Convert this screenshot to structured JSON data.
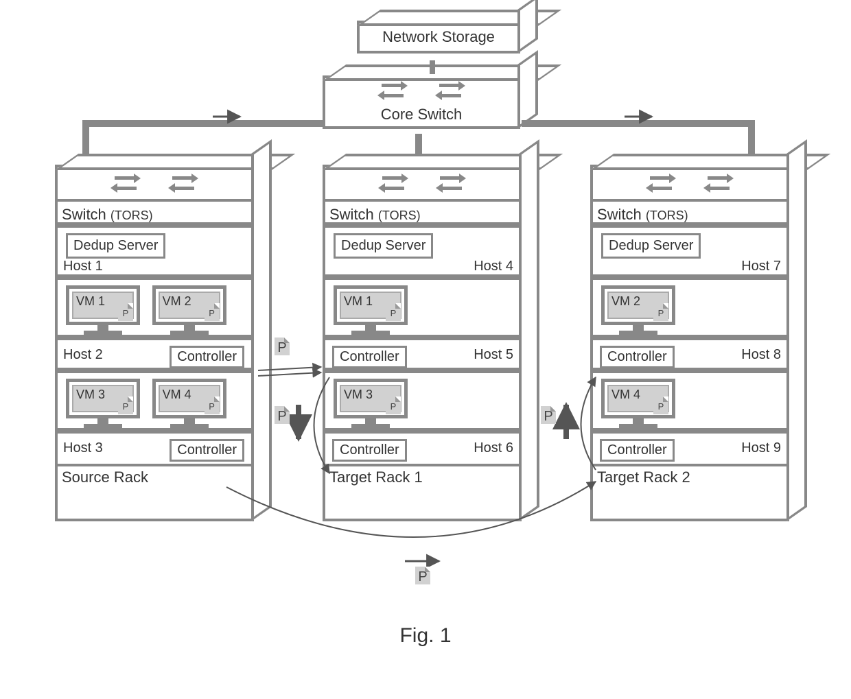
{
  "figure_caption": "Fig. 1",
  "storage_label": "Network Storage",
  "core_switch_label": "Core Switch",
  "switch_label": "Switch",
  "tors_label": "(TORS)",
  "dedup_label": "Dedup Server",
  "controller_label": "Controller",
  "p_label": "P",
  "racks": {
    "source": {
      "name": "Source Rack",
      "host1": "Host 1",
      "host2": "Host 2",
      "host3": "Host 3",
      "vm1": "VM 1",
      "vm2": "VM 2",
      "vm3": "VM 3",
      "vm4": "VM 4"
    },
    "target1": {
      "name": "Target Rack 1",
      "host1": "Host 4",
      "host2": "Host 5",
      "host3": "Host 6",
      "vm1": "VM 1",
      "vm3": "VM 3"
    },
    "target2": {
      "name": "Target Rack 2",
      "host1": "Host 7",
      "host2": "Host 8",
      "host3": "Host 9",
      "vm2": "VM 2",
      "vm4": "VM 4"
    }
  },
  "chart_data": {
    "type": "network-diagram",
    "nodes": [
      {
        "id": "net_storage",
        "label": "Network Storage"
      },
      {
        "id": "core_switch",
        "label": "Core Switch"
      },
      {
        "id": "rack_src",
        "label": "Source Rack",
        "contains": [
          "Switch (TORS)",
          "Host 1 (Dedup Server)",
          "Host 2 (VM 1, VM 2, Controller)",
          "Host 3 (VM 3, VM 4, Controller)"
        ]
      },
      {
        "id": "rack_t1",
        "label": "Target Rack 1",
        "contains": [
          "Switch (TORS)",
          "Host 4 (Dedup Server)",
          "Host 5 (VM 1, Controller)",
          "Host 6 (VM 3, Controller)"
        ]
      },
      {
        "id": "rack_t2",
        "label": "Target Rack 2",
        "contains": [
          "Switch (TORS)",
          "Host 7 (Dedup Server)",
          "Host 8 (VM 2, Controller)",
          "Host 9 (VM 4, Controller)"
        ]
      }
    ],
    "edges": [
      {
        "from": "net_storage",
        "to": "core_switch"
      },
      {
        "from": "core_switch",
        "to": "rack_src"
      },
      {
        "from": "core_switch",
        "to": "rack_t1"
      },
      {
        "from": "core_switch",
        "to": "rack_t2"
      },
      {
        "from": "rack_src.Host2.Controller",
        "to": "rack_t1.Host5.Controller",
        "payload": "P"
      },
      {
        "from": "rack_t1.Host5.Controller",
        "to": "rack_t1.Host6.Controller",
        "payload": "P"
      },
      {
        "from": "rack_src.Host3.Controller",
        "to": "rack_t2.Host9.Controller",
        "payload": "P"
      },
      {
        "from": "rack_t2.Host9.Controller",
        "to": "rack_t2.Host8.Controller",
        "payload": "P"
      }
    ]
  }
}
